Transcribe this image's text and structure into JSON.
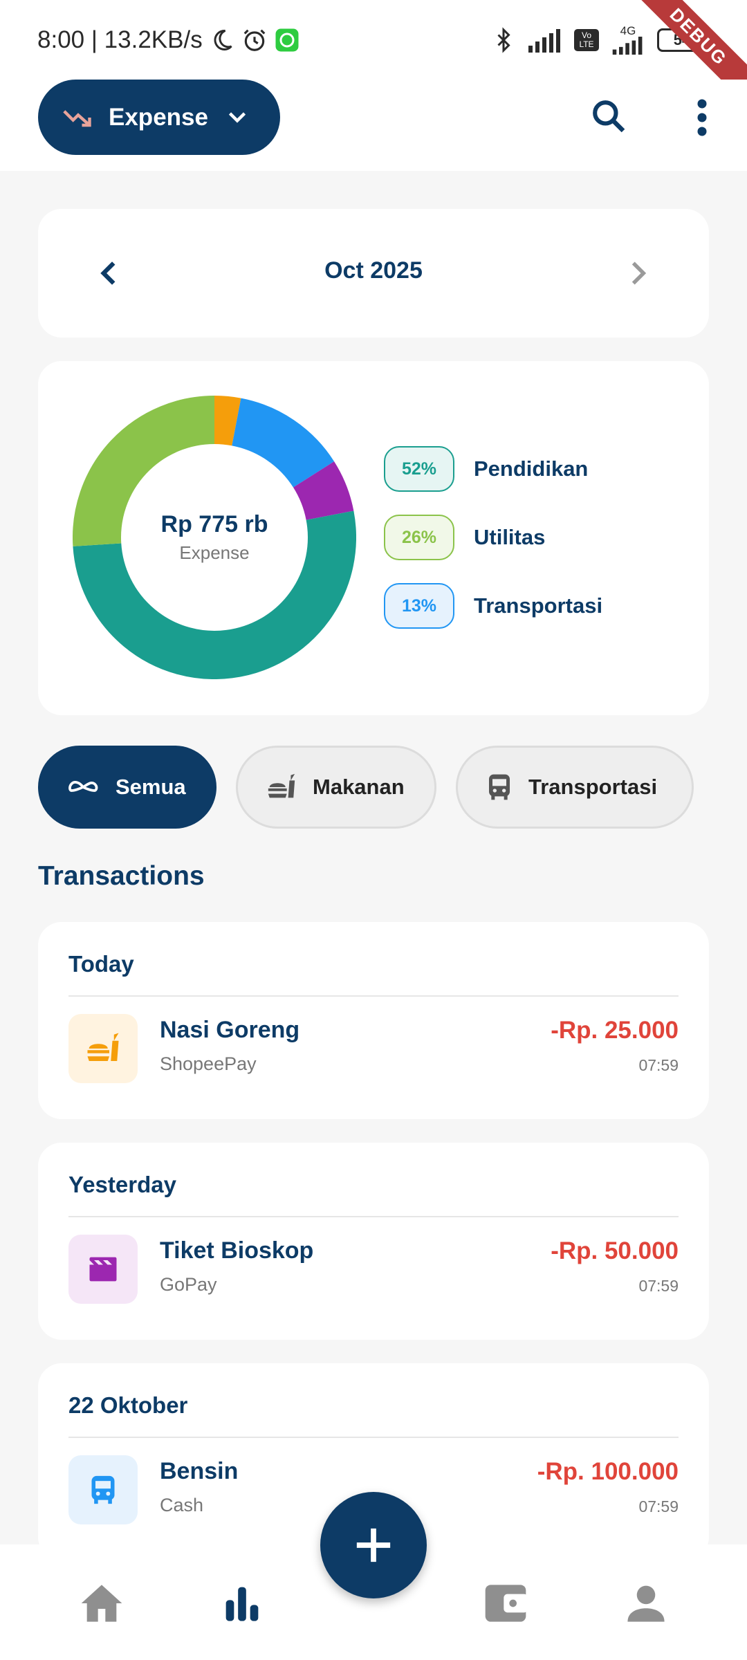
{
  "status_bar": {
    "time_speed": "8:00 | 13.2KB/s",
    "network": "4G",
    "volte": "Vo LTE",
    "battery": "54",
    "debug_banner": "DEBUG"
  },
  "app_bar": {
    "mode_label": "Expense",
    "mode_icon": "trending-down-icon",
    "mode_icon_color": "#e8a39a"
  },
  "month_selector": {
    "label": "Oct 2025"
  },
  "summary": {
    "total": "Rp 775 rb",
    "subtitle": "Expense",
    "legend": [
      {
        "percent": "52%",
        "name": "Pendidikan",
        "color": "#1a9e8f",
        "bg": "#e6f5f3"
      },
      {
        "percent": "26%",
        "name": "Utilitas",
        "color": "#8bc34a",
        "bg": "#f1f8e8"
      },
      {
        "percent": "13%",
        "name": "Transportasi",
        "color": "#2196f3",
        "bg": "#e6f2fd"
      }
    ]
  },
  "chart_data": {
    "type": "pie",
    "slices": [
      {
        "color": "#1a9e8f",
        "value": 52
      },
      {
        "color": "#8bc34a",
        "value": 26
      },
      {
        "color": "#f59e0b",
        "value": 3
      },
      {
        "color": "#2196f3",
        "value": 13
      },
      {
        "color": "#9c27b0",
        "value": 6
      }
    ]
  },
  "filters": [
    {
      "label": "Semua",
      "icon": "infinity-icon",
      "active": true
    },
    {
      "label": "Makanan",
      "icon": "fastfood-icon",
      "active": false
    },
    {
      "label": "Transportasi",
      "icon": "bus-icon",
      "active": false
    }
  ],
  "transactions_title": "Transactions",
  "transaction_groups": [
    {
      "title": "Today",
      "items": [
        {
          "name": "Nasi Goreng",
          "method": "ShopeePay",
          "amount": "-Rp. 25.000",
          "time": "07:59",
          "icon": "fastfood-icon",
          "icon_color": "#f59e0b",
          "icon_bg": "#fff3e0"
        }
      ]
    },
    {
      "title": "Yesterday",
      "items": [
        {
          "name": "Tiket Bioskop",
          "method": "GoPay",
          "amount": "-Rp. 50.000",
          "time": "07:59",
          "icon": "movie-icon",
          "icon_color": "#9c27b0",
          "icon_bg": "#f5e6f7"
        }
      ]
    },
    {
      "title": "22 Oktober",
      "items": [
        {
          "name": "Bensin",
          "method": "Cash",
          "amount": "-Rp. 100.000",
          "time": "07:59",
          "icon": "bus-icon",
          "icon_color": "#2196f3",
          "icon_bg": "#e6f2fd"
        }
      ]
    }
  ],
  "bottom_nav": [
    {
      "name": "home-icon"
    },
    {
      "name": "stats-icon",
      "active": true
    },
    {
      "name": "wallet-icon"
    },
    {
      "name": "profile-icon"
    }
  ],
  "colors": {
    "primary": "#0d3b66",
    "expense_red": "#e0443a",
    "nav_inactive": "#8f8f8f"
  }
}
